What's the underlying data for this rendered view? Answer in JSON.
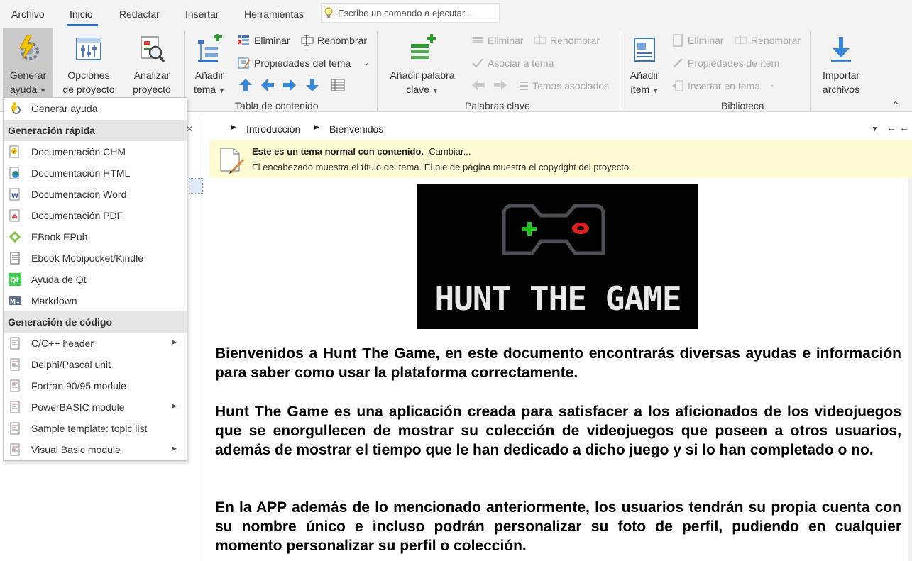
{
  "menubar": {
    "tabs": [
      "Archivo",
      "Inicio",
      "Redactar",
      "Insertar",
      "Herramientas"
    ],
    "command_placeholder": "Escribe un comando a ejecutar..."
  },
  "ribbon": {
    "generar": {
      "l1": "Generar",
      "l2": "ayuda"
    },
    "opciones": {
      "l1": "Opciones",
      "l2": "de proyecto"
    },
    "analizar": {
      "l1": "Analizar",
      "l2": "proyecto"
    },
    "anadir_tema": {
      "l1": "Añadir",
      "l2": "tema"
    },
    "toc": {
      "eliminar": "Eliminar",
      "renombrar": "Renombrar",
      "propiedades": "Propiedades del tema",
      "group_label": "Tabla de contenido"
    },
    "keywords": {
      "anadir": {
        "l1": "Añadir palabra",
        "l2": "clave"
      },
      "eliminar": "Eliminar",
      "renombrar": "Renombrar",
      "asociar": "Asociar a tema",
      "asociados": "Temas asociados",
      "group_label": "Palabras clave"
    },
    "library": {
      "anadir": {
        "l1": "Añadir",
        "l2": "ítem"
      },
      "eliminar": "Eliminar",
      "renombrar": "Renombrar",
      "propiedades": "Propiedades de ítem",
      "insertar": "Insertar en tema",
      "group_label": "Biblioteca"
    },
    "importar": {
      "l1": "Importar",
      "l2": "archivos"
    }
  },
  "breadcrumb": [
    "Introducción",
    "Bienvenidos"
  ],
  "info_bar": {
    "bold": "Este es un tema normal con contenido.",
    "change": "Cambiar...",
    "line2": "El encabezado muestra el título del tema.   El pie de página muestra el copyright del proyecto."
  },
  "content": {
    "logo_text": "HUNT THE GAME",
    "paragraphs": [
      "Bienvenidos a Hunt The Game, en este documento encontrarás diversas ayudas e información para saber como usar la plataforma correctamente.",
      "Hunt The Game es una aplicación creada para satisfacer a los aficionados de los videojuegos que se enorgullecen de mostrar su colección de videojuegos que poseen a otros usuarios, además de mostrar el tiempo que le han dedicado a dicho juego y si lo han completado o no.",
      "En la APP además de lo mencionado anteriormente, los usuarios tendrán su propia cuenta con su nombre único e incluso podrán personalizar su foto de perfil, pudiendo en cualquier momento personalizar su perfil o colección."
    ]
  },
  "dropdown": {
    "top_item": "Generar ayuda",
    "header_quick": "Generación rápida",
    "quick": [
      "Documentación CHM",
      "Documentación HTML",
      "Documentación Word",
      "Documentación PDF",
      "EBook EPub",
      "Ebook Mobipocket/Kindle",
      "Ayuda de Qt",
      "Markdown"
    ],
    "header_code": "Generación de código",
    "code": [
      "C/C++ header",
      "Delphi/Pascal unit",
      "Fortran 90/95 module",
      "PowerBASIC module",
      "Sample template: topic list",
      "Visual Basic module"
    ]
  },
  "colors": {
    "accent": "#2b6cc4",
    "info_bg": "#fdfad4",
    "ribbon_bg": "#f3f3f3"
  }
}
